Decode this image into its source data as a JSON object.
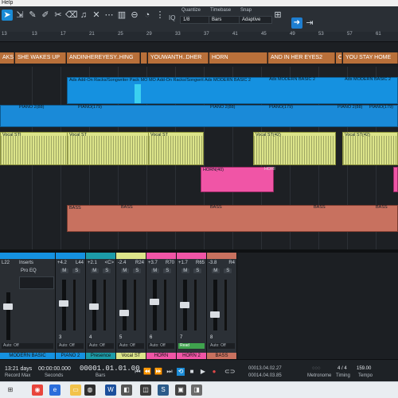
{
  "menu": {
    "help_label": "Help"
  },
  "toolbar": {
    "quantize_label": "Quantize",
    "quantize_value": "1/8",
    "timebase_label": "Timebase",
    "timebase_value": "Bars",
    "snap_label": "Snap",
    "snap_value": "Adaptive",
    "iq_label": "IQ"
  },
  "ruler": {
    "ticks": [
      "13",
      "17",
      "21",
      "25",
      "29",
      "33",
      "37",
      "41",
      "45",
      "49",
      "53",
      "57",
      "61"
    ]
  },
  "markers": [
    "AKS",
    "SHE WAKES UP",
    "ANDINHEREYESY..HING",
    "",
    "YOUWANTH..DHER",
    "HORN",
    "AND IN HER EYES2",
    "C",
    "YOU STAY HOME"
  ],
  "tracks": {
    "track1_header": "Ads Add-On Racks/Songwriter Pack MO MO Add-On Racks/Songwrit Ads MODERN BASIC 2",
    "track1_clip2": "Ads MODERN BASIC 2",
    "track1_clip3": "Ads MODERN BASIC 2",
    "piano_clips": [
      "PIANO 2(88)",
      "PIANO(179)",
      "PIANO 2(88)",
      "PIANO(179)",
      "PIANO 2(88)",
      "PIANO(179)"
    ],
    "vocal_clips": [
      "Vocal STI",
      "Vocal ST",
      "Vocal ST",
      "Vocal ST(42)",
      "Vocal ST(42)"
    ],
    "horn_clips": [
      "HORN(40)",
      "HORI"
    ],
    "bass_clips": [
      "BASS",
      "BASS",
      "BASS",
      "BASS",
      "BASS"
    ]
  },
  "console": {
    "inserts_label": "Inserts",
    "insert_item": "Pro EQ",
    "strips": [
      {
        "vol": "L22",
        "pan": "",
        "num": "",
        "name": "MODERN BASIC",
        "auto": "Auto: Off",
        "color": "#1591e0"
      },
      {
        "vol": "+4.2",
        "pan": "L44",
        "num": "3",
        "name": "PIANO 2",
        "auto": "Auto: Off",
        "color": "#1591e0"
      },
      {
        "vol": "+2.1",
        "pan": "<C>",
        "num": "4",
        "name": "Presence",
        "auto": "Auto: Off",
        "color": "#1c9ba8"
      },
      {
        "vol": "-2.4",
        "pan": "R24",
        "num": "5",
        "name": "Vocal ST",
        "auto": "Auto: Off",
        "color": "#dce48a"
      },
      {
        "vol": "+3.7",
        "pan": "R70",
        "num": "6",
        "name": "HORN",
        "auto": "Auto: Off",
        "color": "#f055a6"
      },
      {
        "vol": "+1.7",
        "pan": "R65",
        "num": "7",
        "name": "HORN 2",
        "auto": "Read",
        "color": "#f055a6"
      },
      {
        "vol": "-3.8",
        "pan": "R4",
        "num": "8",
        "name": "BASS",
        "auto": "Auto: Off",
        "color": "#c8715f"
      }
    ]
  },
  "transport": {
    "record_time": "13:21 days",
    "record_label": "Record Max",
    "seconds_value": "00:00:00.000",
    "seconds_label": "Seconds",
    "bars_value": "00001.01.01.00",
    "bars_label": "Bars",
    "loop_start": "00013.04.02.27",
    "loop_end": "00014.04.03.85",
    "metronome_label": "Metronome",
    "timing_value": "4 / 4",
    "timing_label": "Timing",
    "tempo_value": "159.00",
    "tempo_label": "Tempo"
  },
  "colors": {
    "accent": "#1a8bd6",
    "marker": "#b9703a",
    "blue": "#1591e0",
    "yellow": "#dce48a",
    "pink": "#f055a6",
    "salmon": "#c8715f"
  }
}
